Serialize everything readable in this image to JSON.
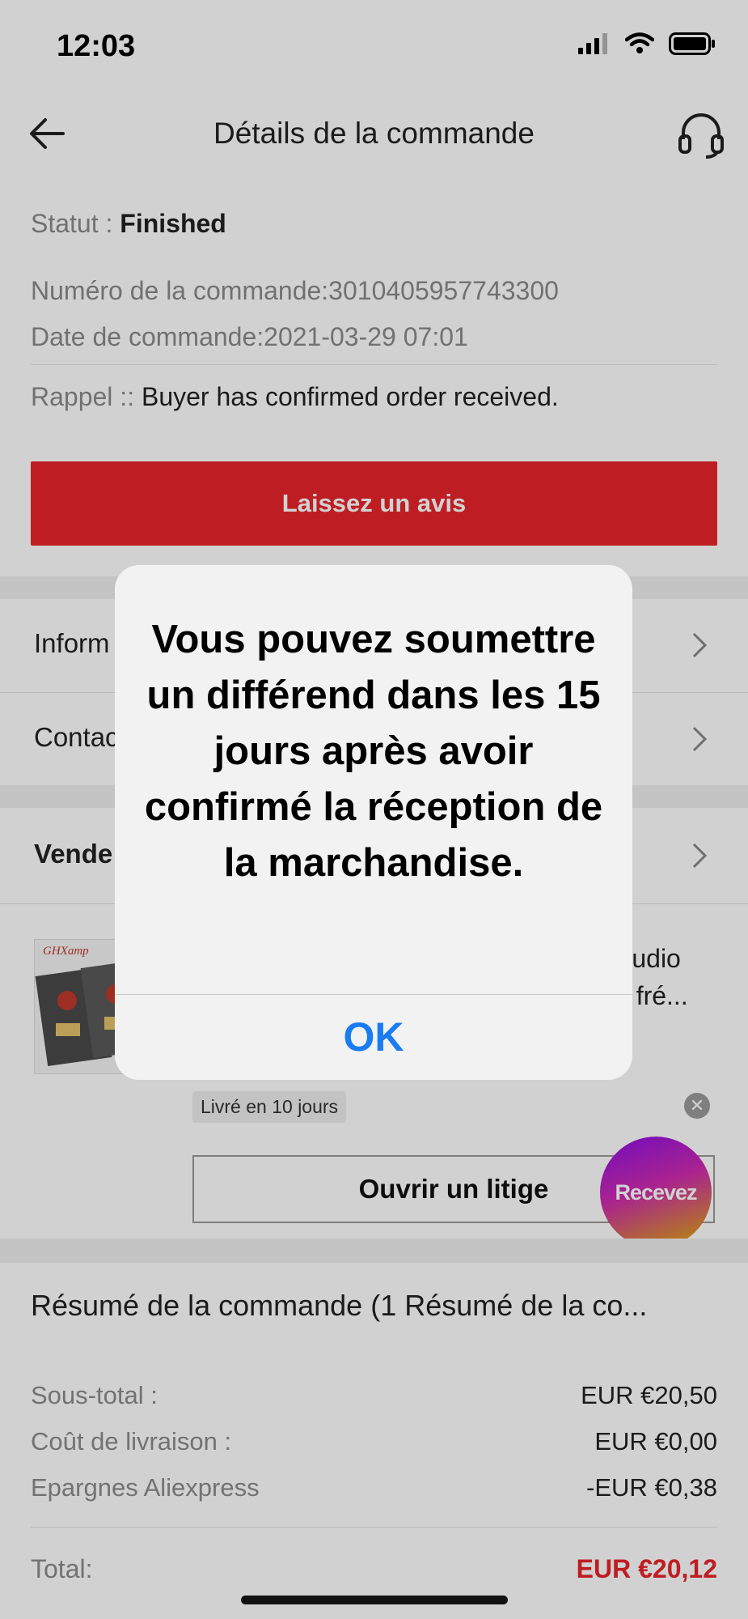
{
  "status_bar": {
    "time": "12:03"
  },
  "header": {
    "title": "Détails de la commande"
  },
  "order": {
    "status_label": "Statut : ",
    "status_value": "Finished",
    "order_number": "Numéro de la commande:3010405957743300",
    "order_date": "Date de commande:2021-03-29 07:01",
    "reminder_label": "Rappel :: ",
    "reminder_value": "Buyer has confirmed order received."
  },
  "review_button": "Laissez un avis",
  "rows": {
    "information": "Inform",
    "contact": "Contac",
    "seller": "Vende"
  },
  "product": {
    "title_line1": "Audio",
    "title_line2": "e fré...",
    "thumb_brand": "GHXamp",
    "delivery_chip": "Livré en 10 jours",
    "dispute_button": "Ouvrir un litige"
  },
  "promo_bubble": "Recevez",
  "summary": {
    "title": "Résumé de la commande (1 Résumé de la co...",
    "subtotal_label": "Sous-total :",
    "subtotal_value": "EUR €20,50",
    "shipping_label": "Coût de livraison :",
    "shipping_value": "EUR €0,00",
    "savings_label": "Epargnes Aliexpress",
    "savings_value": "-EUR €0,38",
    "total_label": "Total:",
    "total_value": "EUR €20,12"
  },
  "alert": {
    "message": "Vous pouvez soumettre un différend dans les 15 jours après avoir confirmé la réception de la marchandise.",
    "ok": "OK"
  },
  "colors": {
    "accent_red": "#e8252b",
    "ios_blue": "#1a7cf2"
  }
}
